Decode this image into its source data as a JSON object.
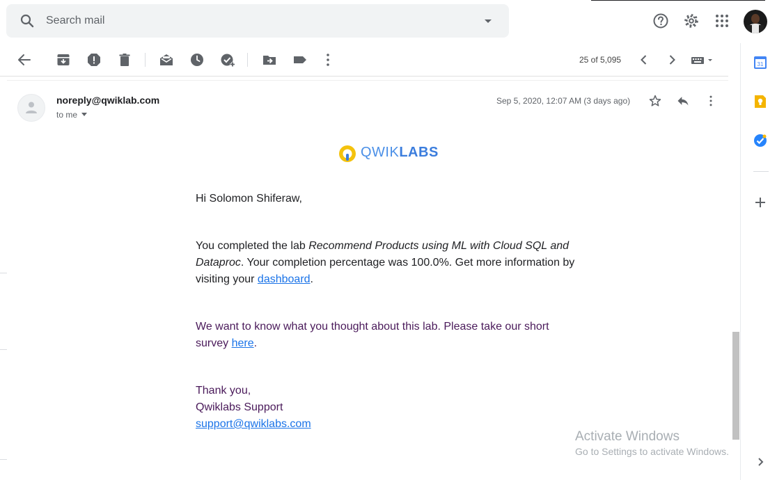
{
  "search": {
    "placeholder": "Search mail",
    "icon": "search-icon"
  },
  "header_icons": [
    "help-icon",
    "settings-icon",
    "apps-grid-icon",
    "account-avatar"
  ],
  "toolbar": {
    "icons": [
      "back-arrow-icon",
      "archive-icon",
      "report-spam-icon",
      "delete-icon",
      "mark-unread-icon",
      "snooze-icon",
      "add-to-tasks-icon",
      "move-to-icon",
      "label-icon",
      "more-vert-icon"
    ],
    "page_count": "25 of 5,095",
    "input_tools_icon": "keyboard-icon"
  },
  "message": {
    "sender": "noreply@qwiklab.com",
    "recipient": "to me",
    "date": "Sep 5, 2020, 12:07 AM (3 days ago)",
    "logo_prefix": "QWIK",
    "logo_suffix": "LABS",
    "greeting": "Hi Solomon Shiferaw,",
    "p1_a": "You completed the lab ",
    "p1_lab_line1": "Recommend Products using ML with Cloud SQL and",
    "p1_lab_line2": "Dataproc",
    "p1_b": ". Your completion percentage was 100.0%. Get more information by",
    "p1_c": "visiting your ",
    "p1_link": "dashboard",
    "p1_end": ".",
    "p2_line1": "We want to know what you thought about this lab. Please take our short",
    "p2_a": "survey ",
    "p2_link": "here",
    "p2_end": ".",
    "signoff1": "Thank you,",
    "signoff2": "Qwiklabs Support",
    "support_email": "support@qwiklabs.com"
  },
  "side_panel": {
    "items": [
      "calendar-icon",
      "keep-icon",
      "tasks-icon",
      "add-addon-icon",
      "expand-panel-icon"
    ],
    "calendar_day": "31"
  },
  "watermark": {
    "line1": "Activate Windows",
    "line2": "Go to Settings to activate Windows."
  },
  "colors": {
    "link": "#1a73e8",
    "purple_text": "#4a1a5a",
    "logo_blue": "#3b7ddd",
    "logo_yellow": "#f4c20d"
  }
}
